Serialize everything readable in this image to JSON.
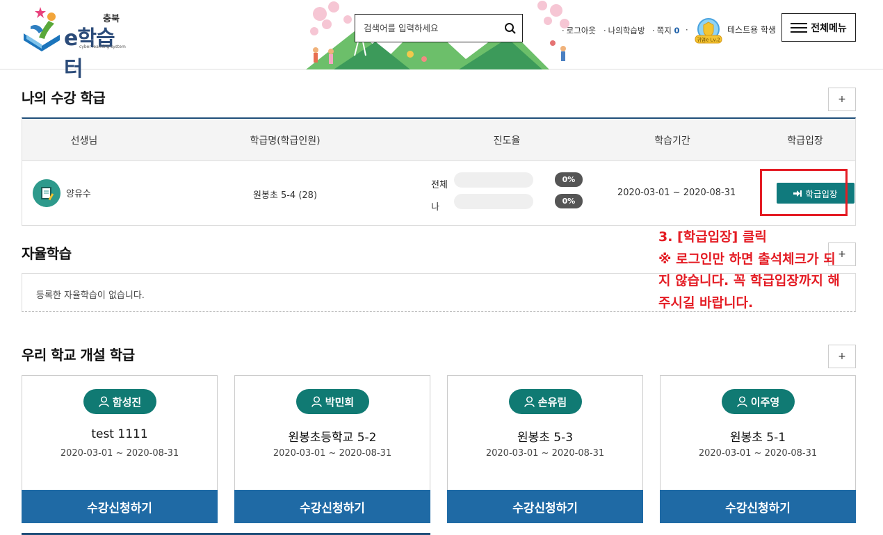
{
  "header": {
    "logo": {
      "region": "충북",
      "name": "e학습터",
      "tagline": "cyber learning system"
    },
    "search": {
      "placeholder": "검색어를 입력하세요",
      "icon": "search-icon"
    },
    "util_links": {
      "logout": "로그아웃",
      "my_room": "나의학습방",
      "message": "쪽지",
      "message_count": "0"
    },
    "badge_text": "귀염e Lv.2",
    "user_name": "테스트용 학생",
    "menu_label": "전체메뉴"
  },
  "my_classes": {
    "title": "나의 수강 학급",
    "more": "+",
    "columns": [
      "선생님",
      "학급명(학급인원)",
      "진도율",
      "학습기간",
      "학급입장"
    ],
    "rows": [
      {
        "teacher": "양유수",
        "class_name": "원봉초 5-4 (28)",
        "progress_total_label": "전체",
        "progress_total": "0%",
        "progress_total_value": 0,
        "progress_mine_label": "나",
        "progress_mine": "0%",
        "progress_mine_value": 0,
        "period": "2020-03-01 ~ 2020-08-31",
        "enter_label": "학급입장"
      }
    ]
  },
  "annotation": {
    "line1": "3. [학급입장] 클릭",
    "line2": "※ 로그인만 하면 출석체크가 되",
    "line3": "지 않습니다. 꼭 학급입장까지 해",
    "line4": "주시길 바랍니다."
  },
  "self_study": {
    "title": "자율학습",
    "more": "+",
    "empty_text": "등록한 자율학습이 없습니다."
  },
  "school_classes": {
    "title": "우리 학교 개설 학급",
    "more": "+",
    "cards": [
      {
        "teacher": "함성진",
        "name": "test 1111",
        "period": "2020-03-01 ~ 2020-08-31",
        "button": "수강신청하기"
      },
      {
        "teacher": "박민희",
        "name": "원봉초등학교 5-2",
        "period": "2020-03-01 ~ 2020-08-31",
        "button": "수강신청하기"
      },
      {
        "teacher": "손유림",
        "name": "원봉초 5-3",
        "period": "2020-03-01 ~ 2020-08-31",
        "button": "수강신청하기"
      },
      {
        "teacher": "이주영",
        "name": "원봉초 5-1",
        "period": "2020-03-01 ~ 2020-08-31",
        "button": "수강신청하기"
      }
    ]
  },
  "colors": {
    "primary_blue": "#1f6aa5",
    "teal": "#107a73",
    "annotation_red": "#e41c24",
    "table_border": "#1f4e79"
  }
}
